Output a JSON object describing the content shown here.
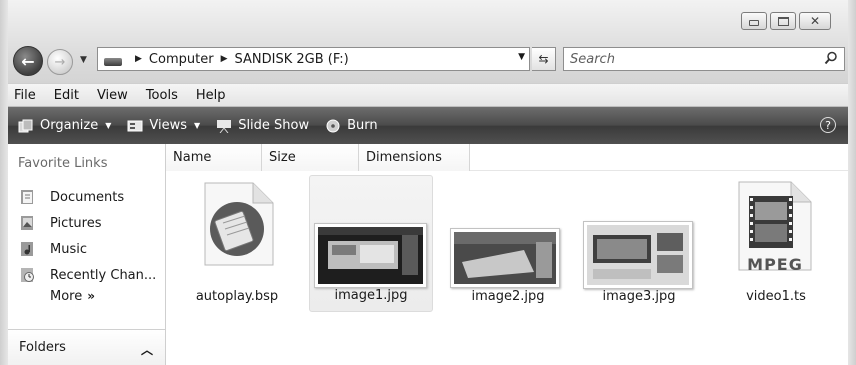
{
  "address": {
    "crumbs": [
      "Computer",
      "SANDISK 2GB (F:)"
    ]
  },
  "search": {
    "placeholder": "Search"
  },
  "menu": [
    "File",
    "Edit",
    "View",
    "Tools",
    "Help"
  ],
  "toolbar": {
    "organize": "Organize",
    "views": "Views",
    "slideshow": "Slide Show",
    "burn": "Burn",
    "help": "?"
  },
  "navpane": {
    "title": "Favorite Links",
    "links": [
      "Documents",
      "Pictures",
      "Music",
      "Recently Chan..."
    ],
    "more": "More",
    "folders": "Folders"
  },
  "columns": [
    "Name",
    "Size",
    "Dimensions"
  ],
  "files": [
    {
      "name": "autoplay.bsp",
      "icon": "notepad-file-icon"
    },
    {
      "name": "image1.jpg",
      "icon": "image-thumbnail",
      "selected": true
    },
    {
      "name": "image2.jpg",
      "icon": "image-thumbnail"
    },
    {
      "name": "image3.jpg",
      "icon": "image-thumbnail"
    },
    {
      "name": "video1.ts",
      "icon": "mpeg-file-icon",
      "badge": "MPEG"
    }
  ]
}
